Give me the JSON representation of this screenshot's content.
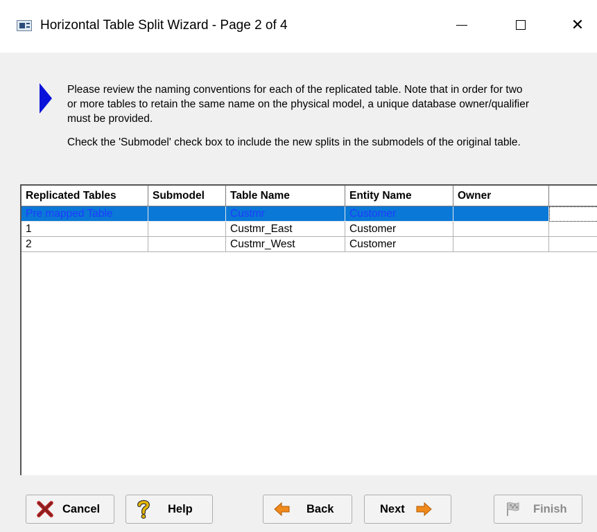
{
  "window": {
    "title": "Horizontal Table Split Wizard - Page 2 of 4"
  },
  "instructions": {
    "paragraph1": "Please review the naming conventions for each of the replicated table. Note that in order for two or more tables to retain the same name on the physical model, a unique database owner/qualifier must be provided.",
    "paragraph2": "Check the 'Submodel' check box to include the new splits in the submodels of the original table."
  },
  "grid": {
    "columns": [
      "Replicated Tables",
      "Submodel",
      "Table Name",
      "Entity Name",
      "Owner",
      ""
    ],
    "rows": [
      {
        "replicated": "Pre mapped Table",
        "submodel": "",
        "table_name": "Custmr",
        "entity_name": "Customer",
        "owner": "",
        "extra": ""
      },
      {
        "replicated": "1",
        "submodel": "",
        "table_name": "Custmr_East",
        "entity_name": "Customer",
        "owner": "",
        "extra": ""
      },
      {
        "replicated": "2",
        "submodel": "",
        "table_name": "Custmr_West",
        "entity_name": "Customer",
        "owner": "",
        "extra": ""
      }
    ]
  },
  "buttons": {
    "cancel": "Cancel",
    "help": "Help",
    "back": "Back",
    "next": "Next",
    "finish": "Finish"
  },
  "icons": {
    "cancel": "x-icon",
    "help": "question-icon",
    "back": "arrow-left-icon",
    "next": "arrow-right-icon",
    "finish": "checkered-flag-icon",
    "info": "pointer-arrow-icon"
  },
  "colors": {
    "accent_arrow": "#0a12d9",
    "selection_bg": "#0a78d7",
    "selection_text": "#1e3cff",
    "cancel_x": "#b22020",
    "nav_arrow": "#f08a1c",
    "help_icon": "#e8b800"
  }
}
